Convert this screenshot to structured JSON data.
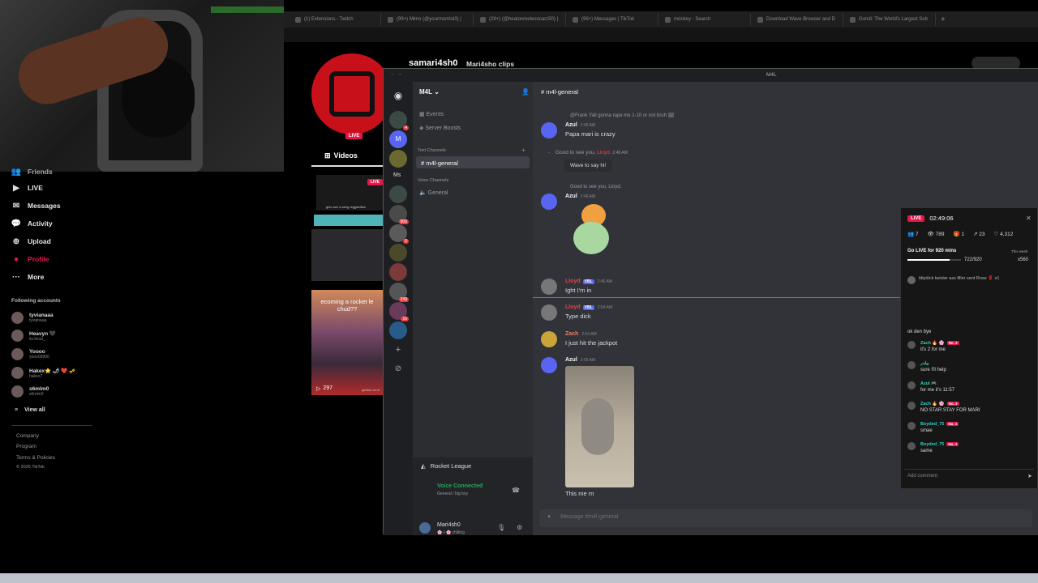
{
  "browser": {
    "tabs": [
      {
        "label": "(1) Extensions - Twitch"
      },
      {
        "label": "(99+) Mimo (@yourmomlol3) |"
      },
      {
        "label": "(29+) (@heatonmeleoncarz50) |"
      },
      {
        "label": "(99+) Messages | TikTok"
      },
      {
        "label": "monkey - Search"
      },
      {
        "label": "Download Wave Browser and D"
      },
      {
        "label": "Gondi: The World's Largest Sub"
      }
    ]
  },
  "tiktok": {
    "nav": [
      {
        "label": "Friends",
        "icon": "friends-icon"
      },
      {
        "label": "LIVE",
        "icon": "live-icon"
      },
      {
        "label": "Messages",
        "icon": "messages-icon",
        "badge": "99+"
      },
      {
        "label": "Activity",
        "icon": "activity-icon",
        "badge": "99+"
      },
      {
        "label": "Upload",
        "icon": "upload-icon"
      },
      {
        "label": "Profile",
        "icon": "profile-icon"
      },
      {
        "label": "More",
        "icon": "more-icon"
      }
    ],
    "following_title": "Following accounts",
    "following": [
      {
        "name": "tyvianaaa",
        "handle": "tyvianaaa"
      },
      {
        "name": "Heavyn 🖤",
        "handle": "itz.heav_"
      },
      {
        "name": "Yoooo",
        "handle": "yooo09990"
      },
      {
        "name": "Hakex⭐ 🌶 ❤️ 🎺",
        "handle": "hakex7"
      },
      {
        "name": "s6mlm0",
        "handle": "s6mlm0"
      }
    ],
    "view_all": "View all",
    "footer": [
      "Company",
      "Program",
      "Terms & Policies",
      "© 2026 TikTok"
    ],
    "profile": {
      "username": "samari4sh0",
      "display_name": "Mari4sho clips",
      "live_label": "LIVE",
      "videos_tab": "Videos",
      "video_caption": "ecoming a rocket le chud??",
      "views": "297",
      "thumb1_caption": "gfxo see a seeg reggaellian",
      "thumb1_live": "LIVE",
      "thumb4_caption": "gfotlon on.nl"
    }
  },
  "discord": {
    "window_title": "M4L",
    "server_name": "M4L",
    "server_badges": [
      "4",
      "",
      "",
      "906",
      "2",
      "",
      "",
      "249",
      "16"
    ],
    "server_ms": "Ms",
    "events": "Events",
    "server_boosts": "Server Boosts",
    "text_channels": "Text Channels",
    "voice_channels": "Voice Channels",
    "active_channel": "m4l-general",
    "voice_channel": "General",
    "rocket_league": "Rocket League",
    "voice_connected": "Voice Connected",
    "voice_sub": "General / big boy",
    "user_name": "Mari4sh0",
    "user_status": "🌸-!-🌸 chilling",
    "chat_header": "m4l-general",
    "input_placeholder": "Message #m4l-general",
    "messages": {
      "reply1": "@Frank Yall gonna rape me 1-10 or not bruh 🖼",
      "m1_author": "Azul",
      "m1_time": "2:45 AM",
      "m1_text": "Papa mari is crazy",
      "sys1_pre": "Good to see you, ",
      "sys1_name": "Lloyd.",
      "sys1_time": "2:46 AM",
      "wave": "Wave to say hi!",
      "reply2": "Good to see you, Lloyd.",
      "m2_author": "Azul",
      "m2_time": "2:46 AM",
      "m3_author": "Lloyd",
      "m3_tag": "VBL",
      "m3_time": "2:46 AM",
      "m3_text": "Ight I'm in",
      "m4_author": "Lloyd",
      "m4_tag": "VBL",
      "m4_time": "2:54 AM",
      "m4_text": "Type dick",
      "m5_author": "Zach",
      "m5_time": "2:54 AM",
      "m5_text": "I just hit the jackpot",
      "m6_author": "Azul",
      "m6_time": "2:55 AM",
      "m6_text": "This me rn"
    }
  },
  "live_panel": {
    "live": "LIVE",
    "timer": "02:49:06",
    "stats": [
      "7",
      "789",
      "1",
      "23",
      "4,312"
    ],
    "goal_title": "Go LIVE for 920 mins",
    "goal_value": "722/920",
    "goal_progress": 0.785,
    "this_week": "This week",
    "coins": "x560",
    "gift_text": "tittydick twister ass filler sent Rose 🌹 x1",
    "comments": [
      {
        "user": "",
        "text": "ok den bye"
      },
      {
        "user": "Zach 🔥 🌸",
        "lvl": "No. 2",
        "text": "it's 2 for me"
      },
      {
        "user": "بيلدر",
        "text": "sure I'll help"
      },
      {
        "user": "Azul 🎮",
        "text": "for me it's 11:57"
      },
      {
        "user": "Zach 🔥 🌸",
        "lvl": "No. 2",
        "text": "NO STAR STAY FOR MARI"
      },
      {
        "user": "Boyded_75",
        "lvl": "No. 1",
        "text": "smae"
      },
      {
        "user": "Boyded_75",
        "lvl": "No. 1",
        "text": "same"
      }
    ],
    "add_comment": "Add comment"
  },
  "colors": {
    "accent": "#e8154a",
    "discord_blurple": "#5865f2",
    "lloyd": "#f23f43",
    "zach": "#f47b67"
  }
}
